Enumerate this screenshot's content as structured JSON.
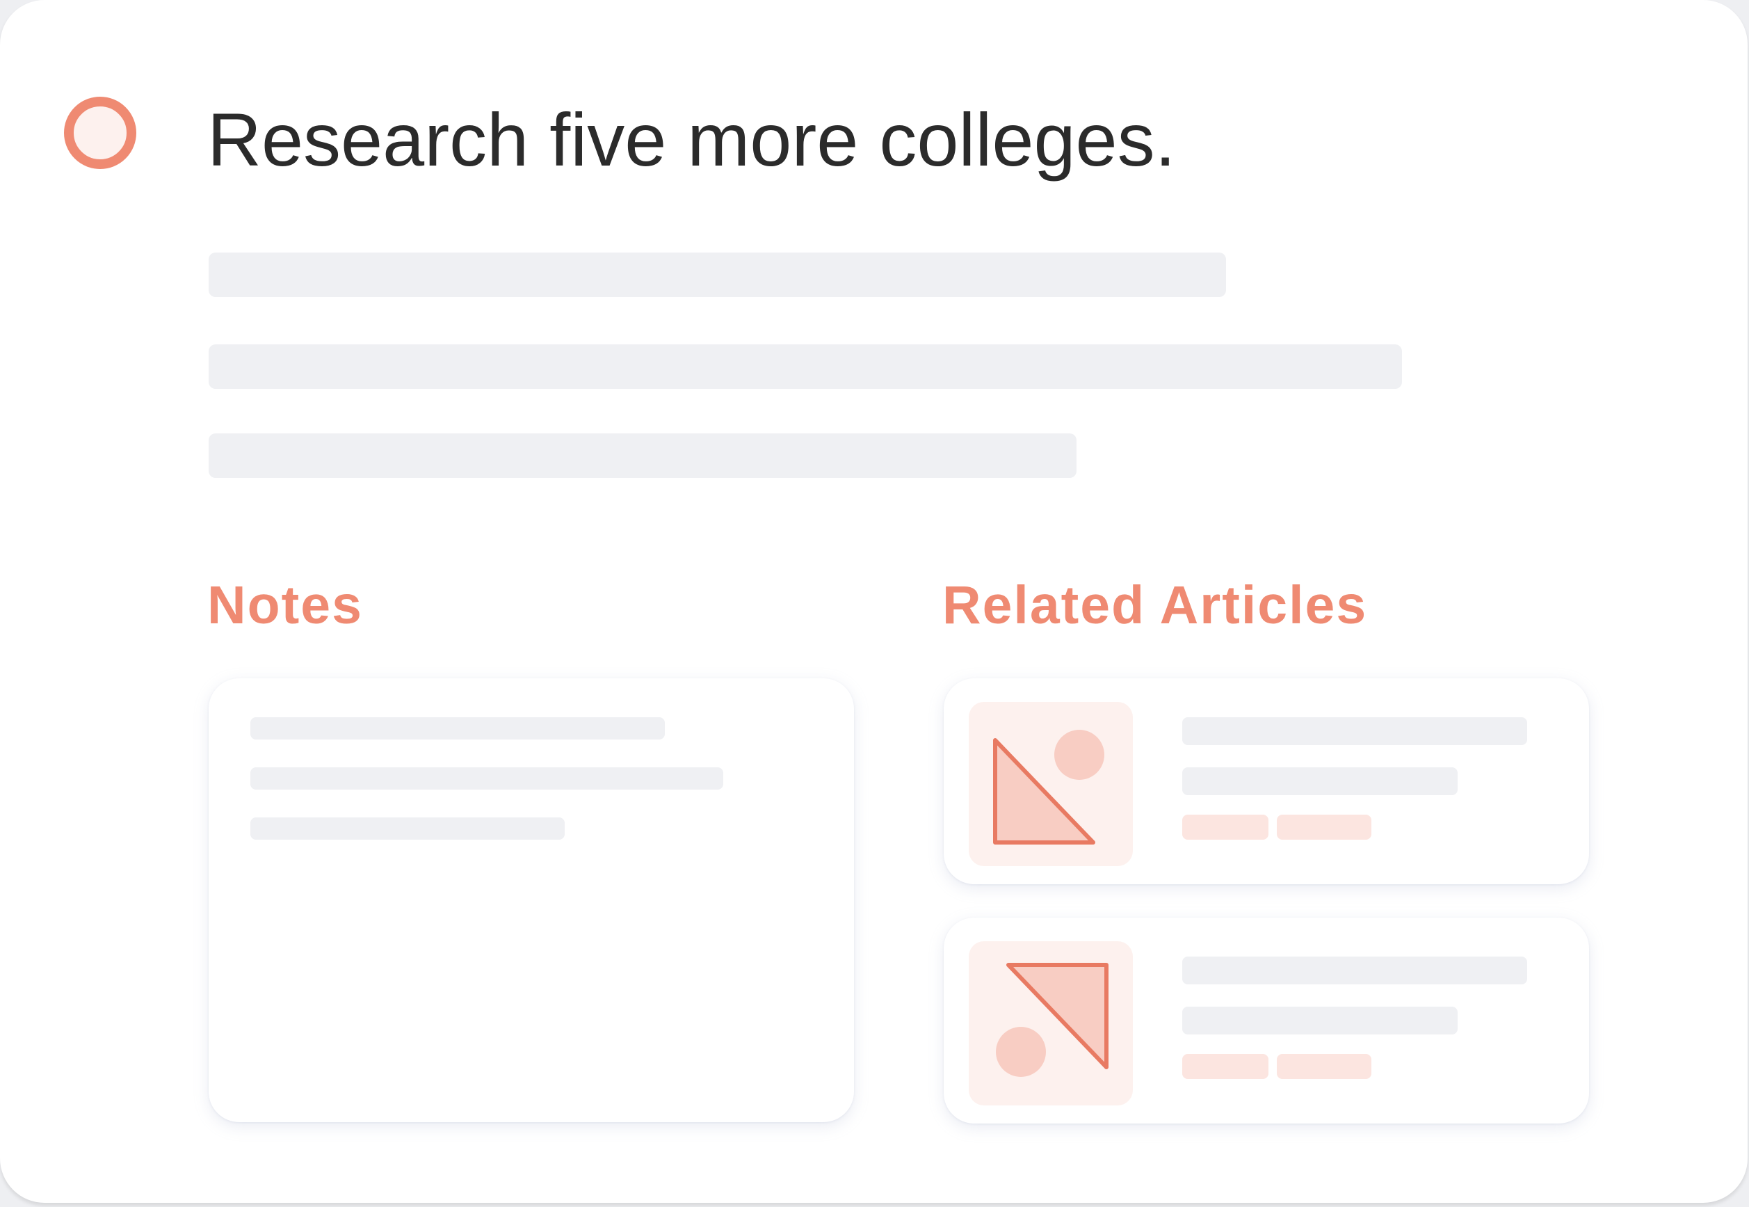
{
  "task": {
    "title": "Research five more colleges."
  },
  "sections": {
    "notes_heading": "Notes",
    "related_heading": "Related Articles"
  },
  "colors": {
    "accent": "#ef8a72",
    "accent_light": "#fdf1ee",
    "accent_fill": "#f8cdc3",
    "tag": "#fce5e0",
    "placeholder": "#eff0f3",
    "text": "#2b2b2b"
  },
  "icons": {
    "checkbox": "circle-checkbox-icon",
    "article_thumbnail": "shapes-image-icon"
  }
}
